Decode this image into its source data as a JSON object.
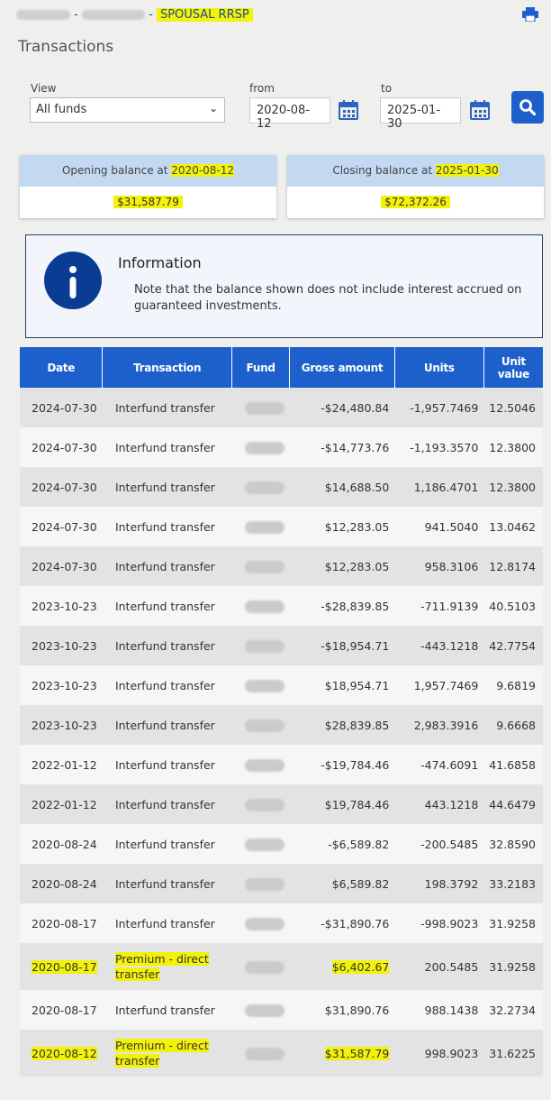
{
  "header": {
    "breadcrumb_prefix": "... - ...",
    "breadcrumb_account": "SPOUSAL RRSP",
    "title": "Transactions",
    "print_icon": "printer-icon"
  },
  "filters": {
    "view_label": "View",
    "view_value": "All funds",
    "from_label": "from",
    "from_value": "2020-08-12",
    "to_label": "to",
    "to_value": "2025-01-30",
    "calendar_icon": "calendar-icon",
    "search_icon": "search-icon"
  },
  "balances": {
    "opening_label": "Opening balance at ",
    "opening_date": "2020-08-12",
    "opening_value": "$31,587.79",
    "closing_label": "Closing balance at ",
    "closing_date": "2025-01-30",
    "closing_value": "$72,372.26"
  },
  "info": {
    "icon": "info-icon",
    "title": "Information",
    "text": "Note that the balance shown does not include interest accrued on guaranteed investments."
  },
  "table": {
    "columns": [
      "Date",
      "Transaction",
      "Fund",
      "Gross amount",
      "Units",
      "Unit value"
    ],
    "rows": [
      {
        "date": "2024-07-30",
        "transaction": "Interfund transfer",
        "fund": "",
        "gross": "-$24,480.84",
        "units": "-1,957.7469",
        "unit_value": "12.5046"
      },
      {
        "date": "2024-07-30",
        "transaction": "Interfund transfer",
        "fund": "",
        "gross": "-$14,773.76",
        "units": "-1,193.3570",
        "unit_value": "12.3800"
      },
      {
        "date": "2024-07-30",
        "transaction": "Interfund transfer",
        "fund": "",
        "gross": "$14,688.50",
        "units": "1,186.4701",
        "unit_value": "12.3800"
      },
      {
        "date": "2024-07-30",
        "transaction": "Interfund transfer",
        "fund": "",
        "gross": "$12,283.05",
        "units": "941.5040",
        "unit_value": "13.0462"
      },
      {
        "date": "2024-07-30",
        "transaction": "Interfund transfer",
        "fund": "",
        "gross": "$12,283.05",
        "units": "958.3106",
        "unit_value": "12.8174"
      },
      {
        "date": "2023-10-23",
        "transaction": "Interfund transfer",
        "fund": "",
        "gross": "-$28,839.85",
        "units": "-711.9139",
        "unit_value": "40.5103"
      },
      {
        "date": "2023-10-23",
        "transaction": "Interfund transfer",
        "fund": "",
        "gross": "-$18,954.71",
        "units": "-443.1218",
        "unit_value": "42.7754"
      },
      {
        "date": "2023-10-23",
        "transaction": "Interfund transfer",
        "fund": "",
        "gross": "$18,954.71",
        "units": "1,957.7469",
        "unit_value": "9.6819"
      },
      {
        "date": "2023-10-23",
        "transaction": "Interfund transfer",
        "fund": "",
        "gross": "$28,839.85",
        "units": "2,983.3916",
        "unit_value": "9.6668"
      },
      {
        "date": "2022-01-12",
        "transaction": "Interfund transfer",
        "fund": "",
        "gross": "-$19,784.46",
        "units": "-474.6091",
        "unit_value": "41.6858"
      },
      {
        "date": "2022-01-12",
        "transaction": "Interfund transfer",
        "fund": "",
        "gross": "$19,784.46",
        "units": "443.1218",
        "unit_value": "44.6479"
      },
      {
        "date": "2020-08-24",
        "transaction": "Interfund transfer",
        "fund": "",
        "gross": "-$6,589.82",
        "units": "-200.5485",
        "unit_value": "32.8590"
      },
      {
        "date": "2020-08-24",
        "transaction": "Interfund transfer",
        "fund": "",
        "gross": "$6,589.82",
        "units": "198.3792",
        "unit_value": "33.2183"
      },
      {
        "date": "2020-08-17",
        "transaction": "Interfund transfer",
        "fund": "",
        "gross": "-$31,890.76",
        "units": "-998.9023",
        "unit_value": "31.9258"
      },
      {
        "date": "2020-08-17",
        "transaction": "Premium - direct transfer",
        "fund": "",
        "gross": "$6,402.67",
        "units": "200.5485",
        "unit_value": "31.9258",
        "highlighted": true
      },
      {
        "date": "2020-08-17",
        "transaction": "Interfund transfer",
        "fund": "",
        "gross": "$31,890.76",
        "units": "988.1438",
        "unit_value": "32.2734"
      },
      {
        "date": "2020-08-12",
        "transaction": "Premium - direct transfer",
        "fund": "",
        "gross": "$31,587.79",
        "units": "998.9023",
        "unit_value": "31.6225",
        "highlighted": true
      }
    ]
  },
  "colors": {
    "primary": "#1d60cc",
    "balance_header": "#c3d9f2",
    "info_icon": "#0b3c94",
    "highlight": "#f2f20a"
  }
}
